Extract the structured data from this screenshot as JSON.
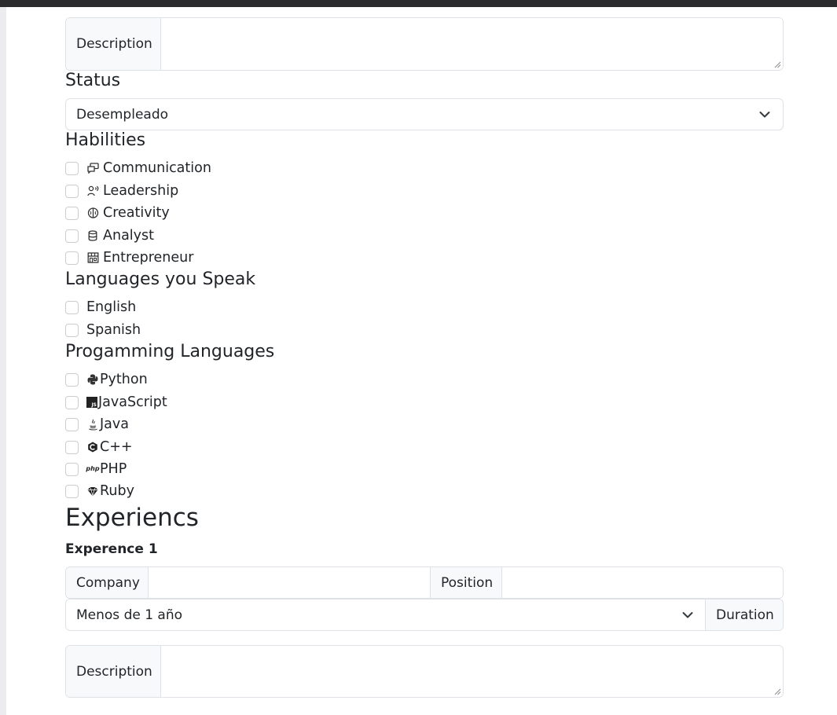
{
  "description_top": {
    "label": "Description",
    "value": ""
  },
  "status": {
    "heading": "Status",
    "selected": "Desempleado"
  },
  "habilities": {
    "heading": "Habilities",
    "items": [
      {
        "label": "Communication",
        "icon": "chat-bubbles-icon"
      },
      {
        "label": "Leadership",
        "icon": "person-speaking-icon"
      },
      {
        "label": "Creativity",
        "icon": "brain-icon"
      },
      {
        "label": "Analyst",
        "icon": "database-icon"
      },
      {
        "label": "Entrepreneur",
        "icon": "shop-icon"
      }
    ]
  },
  "languages": {
    "heading": "Languages you Speak",
    "items": [
      {
        "label": "English"
      },
      {
        "label": "Spanish"
      }
    ]
  },
  "programming": {
    "heading": "Progamming Languages",
    "items": [
      {
        "label": "Python",
        "icon": "python-icon"
      },
      {
        "label": "JavaScript",
        "icon": "javascript-icon",
        "icon_text": "JS"
      },
      {
        "label": "Java",
        "icon": "java-icon"
      },
      {
        "label": "C++",
        "icon": "cplusplus-icon"
      },
      {
        "label": "PHP",
        "icon": "php-icon",
        "icon_text": "php"
      },
      {
        "label": "Ruby",
        "icon": "ruby-icon"
      }
    ]
  },
  "experiences": {
    "heading": "Experiencs",
    "entry_title": "Experence 1",
    "company_label": "Company",
    "company_value": "",
    "position_label": "Position",
    "position_value": "",
    "duration_selected": "Menos de 1 año",
    "duration_label": "Duration",
    "description_label": "Description",
    "description_value": ""
  },
  "colors": {
    "border": "#dee2e6",
    "addon_bg": "#f8f9fa",
    "text": "#212529",
    "topbar": "#2b2b2d"
  }
}
